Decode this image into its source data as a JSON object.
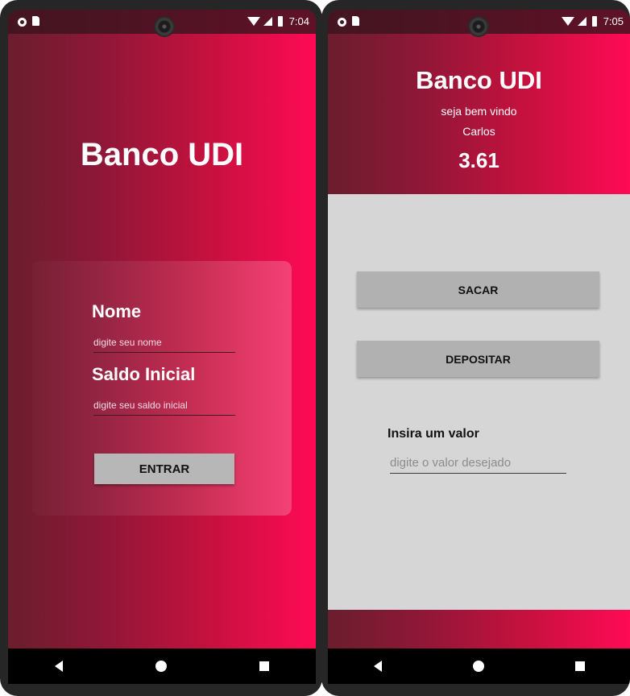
{
  "left_screen": {
    "status": {
      "time": "7:04"
    },
    "title": "Banco UDI",
    "name_label": "Nome",
    "name_placeholder": "digite seu nome",
    "name_value": "",
    "balance_label": "Saldo Inicial",
    "balance_placeholder": "digite seu saldo inicial",
    "balance_value": "",
    "enter_button": "ENTRAR"
  },
  "right_screen": {
    "status": {
      "time": "7:05"
    },
    "title": "Banco UDI",
    "welcome": "seja bem vindo",
    "user_name": "Carlos",
    "balance": "3.61",
    "withdraw_button": "SACAR",
    "deposit_button": "DEPOSITAR",
    "amount_label": "Insira um valor",
    "amount_placeholder": "digite o valor desejado",
    "amount_value": ""
  },
  "icons": {
    "status": [
      "notification-dot-icon",
      "sim-card-icon",
      "wifi-icon",
      "signal-icon",
      "battery-icon"
    ],
    "navigation": [
      "back-icon",
      "home-icon",
      "recent-apps-icon"
    ]
  },
  "colors": {
    "gradient_start": "#6a1e2d",
    "gradient_end": "#ff0a55",
    "body_background": "#d6d6d6",
    "button_background": "#b1b1b1",
    "navbar": "#000000"
  }
}
